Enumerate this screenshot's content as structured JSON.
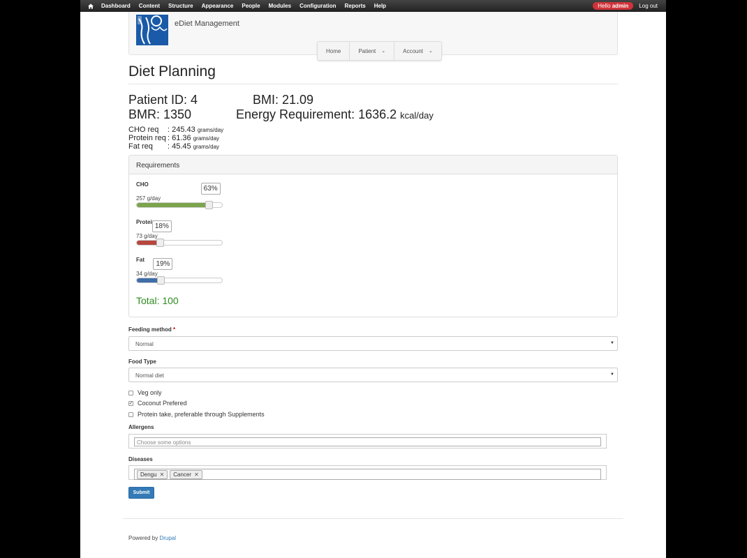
{
  "toolbar": {
    "items": [
      "Dashboard",
      "Content",
      "Structure",
      "Appearance",
      "People",
      "Modules",
      "Configuration",
      "Reports",
      "Help"
    ],
    "hello_prefix": "Hello ",
    "user": "admin",
    "logout": "Log out"
  },
  "header": {
    "site_name": "eDiet Management",
    "nav": [
      {
        "label": "Home",
        "dropdown": false
      },
      {
        "label": "Patient",
        "dropdown": true
      },
      {
        "label": "Account",
        "dropdown": true
      }
    ]
  },
  "page_title": "Diet Planning",
  "stats": {
    "patient_id": "Patient ID: 4",
    "bmi": "BMI: 21.09",
    "bmr": "BMR: 1350",
    "energy": "Energy Requirement: 1636.2",
    "energy_unit": "kcal/day"
  },
  "requirements_text": [
    {
      "key": "CHO req",
      "value": ": 245.43",
      "unit": "grams/day"
    },
    {
      "key": "Protein req",
      "value": ": 61.36",
      "unit": "grams/day"
    },
    {
      "key": "Fat req",
      "value": ": 45.45",
      "unit": "grams/day"
    }
  ],
  "panel": {
    "title": "Requirements",
    "sliders": [
      {
        "label": "CHO",
        "amount": "257 g/day",
        "percent": 63,
        "percent_label": "63%",
        "color": "#7ba44d"
      },
      {
        "label": "Protein",
        "amount": "73 g/day",
        "percent": 18,
        "percent_label": "18%",
        "color": "#b5473f"
      },
      {
        "label": "Fat",
        "amount": "34 g/day",
        "percent": 19,
        "percent_label": "19%",
        "color": "#3f6ea8"
      }
    ],
    "total": "Total: 100"
  },
  "form": {
    "feeding_method": {
      "label": "Feeding method",
      "required_mark": "*",
      "value": "Normal"
    },
    "food_type": {
      "label": "Food Type",
      "value": "Normal diet"
    },
    "checkboxes": [
      {
        "label": "Veg only",
        "checked": false
      },
      {
        "label": "Coconut Prefered",
        "checked": true
      },
      {
        "label": "Protein take, preferable through Supplements",
        "checked": false
      }
    ],
    "allergens": {
      "label": "Allergens",
      "placeholder": "Choose some options"
    },
    "diseases": {
      "label": "Diseases",
      "tags": [
        "Dengu",
        "Cancer"
      ]
    },
    "submit": "Submit"
  },
  "footer": {
    "prefix": "Powered by ",
    "link": "Drupal"
  }
}
